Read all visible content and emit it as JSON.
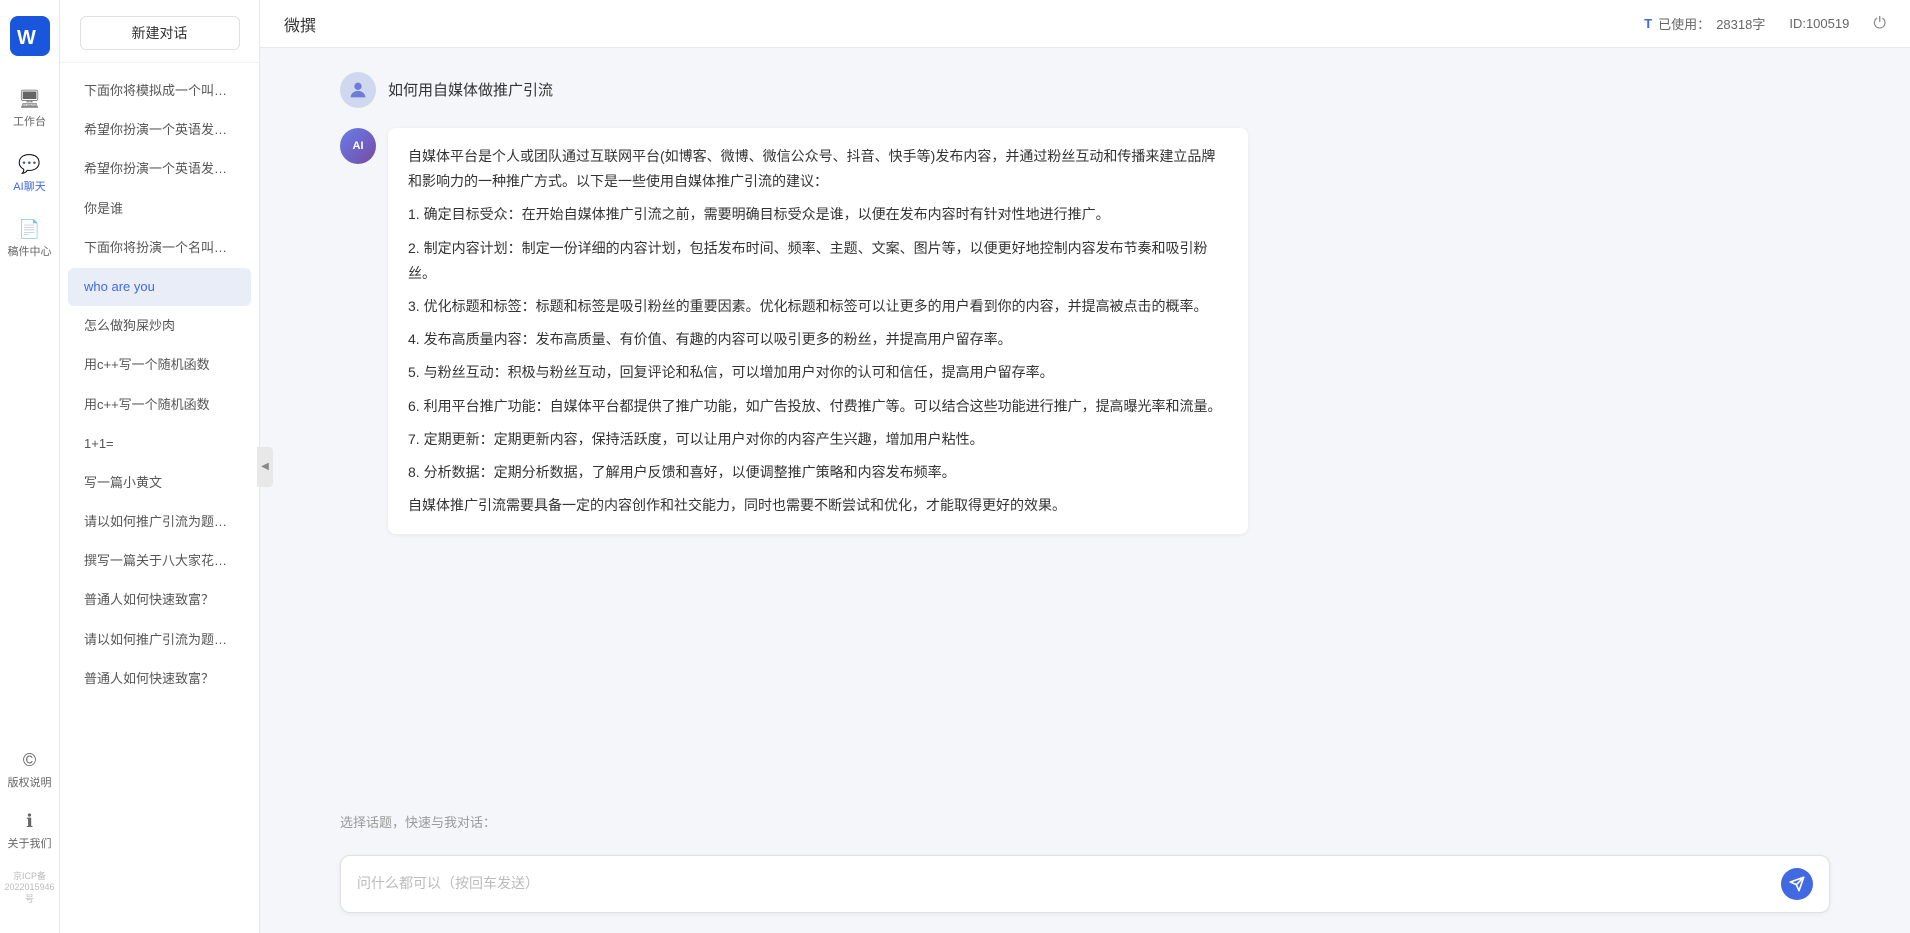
{
  "app": {
    "name": "微撰",
    "logo_text": "W"
  },
  "topbar": {
    "title": "微撰",
    "usage_label": "已使用：",
    "usage_value": "28318字",
    "id_label": "ID:100519",
    "usage_icon": "info-icon"
  },
  "nav": {
    "items": [
      {
        "id": "workbench",
        "label": "工作台",
        "icon": "🖥"
      },
      {
        "id": "ai-chat",
        "label": "AI聊天",
        "icon": "💬",
        "active": true
      },
      {
        "id": "draft",
        "label": "稿件中心",
        "icon": "📄"
      }
    ],
    "bottom_items": [
      {
        "id": "copyright",
        "label": "版权说明",
        "icon": "©"
      },
      {
        "id": "about",
        "label": "关于我们",
        "icon": "ℹ"
      }
    ],
    "icp": "京ICP备2022015946号"
  },
  "sidebar": {
    "new_chat_label": "新建对话",
    "items": [
      {
        "id": 1,
        "text": "下面你将模拟成一个叫圣友的程序员，我说...",
        "active": false
      },
      {
        "id": 2,
        "text": "希望你扮演一个英语发音助手，我提供给你...",
        "active": false
      },
      {
        "id": 3,
        "text": "希望你扮演一个英语发音助手，我提供给你...",
        "active": false
      },
      {
        "id": 4,
        "text": "你是谁",
        "active": false
      },
      {
        "id": 5,
        "text": "下面你将扮演一个名叫圣友的医生",
        "active": false
      },
      {
        "id": 6,
        "text": "who are you",
        "active": true
      },
      {
        "id": 7,
        "text": "怎么做狗屎炒肉",
        "active": false
      },
      {
        "id": 8,
        "text": "用c++写一个随机函数",
        "active": false
      },
      {
        "id": 9,
        "text": "用c++写一个随机函数",
        "active": false
      },
      {
        "id": 10,
        "text": "1+1=",
        "active": false
      },
      {
        "id": 11,
        "text": "写一篇小黄文",
        "active": false
      },
      {
        "id": 12,
        "text": "请以如何推广引流为题，写一篇大纲",
        "active": false
      },
      {
        "id": 13,
        "text": "撰写一篇关于八大家花园社区一刻钟便民生...",
        "active": false
      },
      {
        "id": 14,
        "text": "普通人如何快速致富？",
        "active": false
      },
      {
        "id": 15,
        "text": "请以如何推广引流为题，写一篇大纲",
        "active": false
      },
      {
        "id": 16,
        "text": "普通人如何快速致富？",
        "active": false
      }
    ]
  },
  "chat": {
    "user_question": "如何用自媒体做推广引流",
    "user_avatar_text": "",
    "ai_avatar_text": "AI",
    "ai_response": {
      "intro": "自媒体平台是个人或团队通过互联网平台(如博客、微博、微信公众号、抖音、快手等)发布内容，并通过粉丝互动和传播来建立品牌和影响力的一种推广方式。以下是一些使用自媒体推广引流的建议：",
      "points": [
        "1. 确定目标受众：在开始自媒体推广引流之前，需要明确目标受众是谁，以便在发布内容时有针对性地进行推广。",
        "2. 制定内容计划：制定一份详细的内容计划，包括发布时间、频率、主题、文案、图片等，以便更好地控制内容发布节奏和吸引粉丝。",
        "3. 优化标题和标签：标题和标签是吸引粉丝的重要因素。优化标题和标签可以让更多的用户看到你的内容，并提高被点击的概率。",
        "4. 发布高质量内容：发布高质量、有价值、有趣的内容可以吸引更多的粉丝，并提高用户留存率。",
        "5. 与粉丝互动：积极与粉丝互动，回复评论和私信，可以增加用户对你的认可和信任，提高用户留存率。",
        "6. 利用平台推广功能：自媒体平台都提供了推广功能，如广告投放、付费推广等。可以结合这些功能进行推广，提高曝光率和流量。",
        "7. 定期更新：定期更新内容，保持活跃度，可以让用户对你的内容产生兴趣，增加用户粘性。",
        "8. 分析数据：定期分析数据，了解用户反馈和喜好，以便调整推广策略和内容发布频率。"
      ],
      "conclusion": "自媒体推广引流需要具备一定的内容创作和社交能力，同时也需要不断尝试和优化，才能取得更好的效果。"
    }
  },
  "input": {
    "placeholder": "问什么都可以（按回车发送）",
    "quick_label": "选择话题，快速与我对话："
  }
}
